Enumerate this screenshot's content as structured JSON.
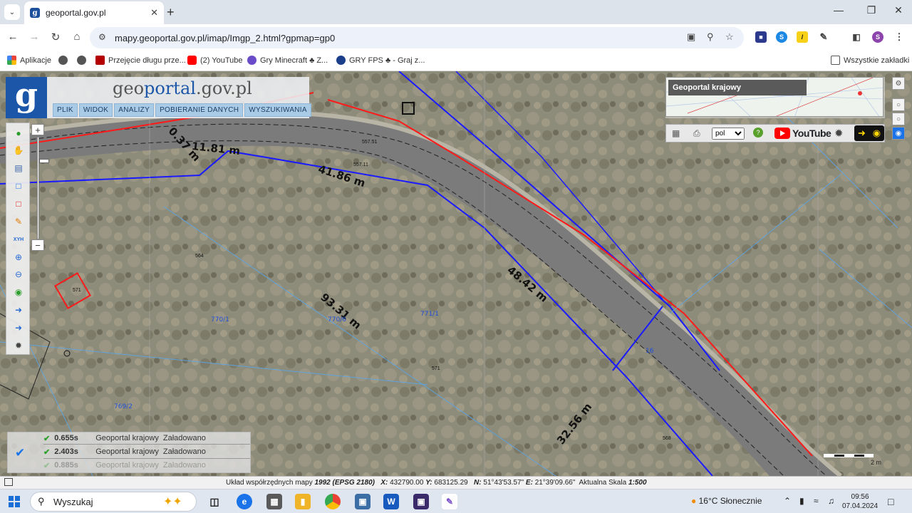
{
  "browser": {
    "tab_title": "geoportal.gov.pl",
    "url": "mapy.geoportal.gov.pl/imap/Imgp_2.html?gpmap=gp0",
    "bookmarks": [
      "Aplikacje",
      "Przejęcie długu prze...",
      "(2) YouTube",
      "Gry Minecraft ♣ Z...",
      "GRY FPS ♣ - Graj z..."
    ],
    "all_bookmarks": "Wszystkie zakładki",
    "colors": {
      "tabstrip": "#dde3ea",
      "omnibox": "#edf2fa"
    }
  },
  "geoportal": {
    "logo_letter": "g",
    "brand_pre": "geo",
    "brand_mid": "portal",
    "brand_post": ".gov.pl",
    "menu": [
      "PLIK",
      "WIDOK",
      "ANALIZY",
      "POBIERANIE DANYCH",
      "WYSZUKIWANIA"
    ],
    "panel_title": "Geoportal krajowy",
    "language": "pol",
    "youtube_label": "YouTube",
    "scale_unit": "2 m"
  },
  "map": {
    "measurements": [
      "0.37 m",
      "11.81 m",
      "41.86 m",
      "48.42 m",
      "93.31 m",
      "32.56 m"
    ],
    "parcels": [
      "770/1",
      "770/6",
      "771/1",
      "769/2",
      "16"
    ],
    "points": [
      "564",
      "571",
      "571",
      "568",
      "557.51",
      "557.11"
    ],
    "colors": {
      "boundary_red": "#ff1a1a",
      "boundary_blue": "#1a1aff",
      "parcel_text": "#1f4fd6"
    }
  },
  "status_popup": {
    "rows": [
      {
        "time": "0.655s",
        "source": "Geoportal krajowy",
        "state": "Załadowano"
      },
      {
        "time": "2.403s",
        "source": "Geoportal krajowy",
        "state": "Załadowano"
      },
      {
        "time": "0.885s",
        "source": "Geoportal krajowy",
        "state": "Załadowano"
      }
    ]
  },
  "map_footer": {
    "prefix": "Układ współrzędnych mapy",
    "system": "1992 (EPSG 2180)",
    "x_label": "X:",
    "x": "432790.00",
    "y_label": "Y:",
    "y": "683125.29",
    "n_label": "N:",
    "n": "51°43'53.57\"",
    "e_label": "E:",
    "e": "21°39'09.66\"",
    "scale_label": "Aktualna Skala",
    "scale": "1:500"
  },
  "taskbar": {
    "search": "Wyszukaj",
    "weather": "16°C  Słonecznie",
    "time": "09:56",
    "date": "07.04.2024"
  }
}
